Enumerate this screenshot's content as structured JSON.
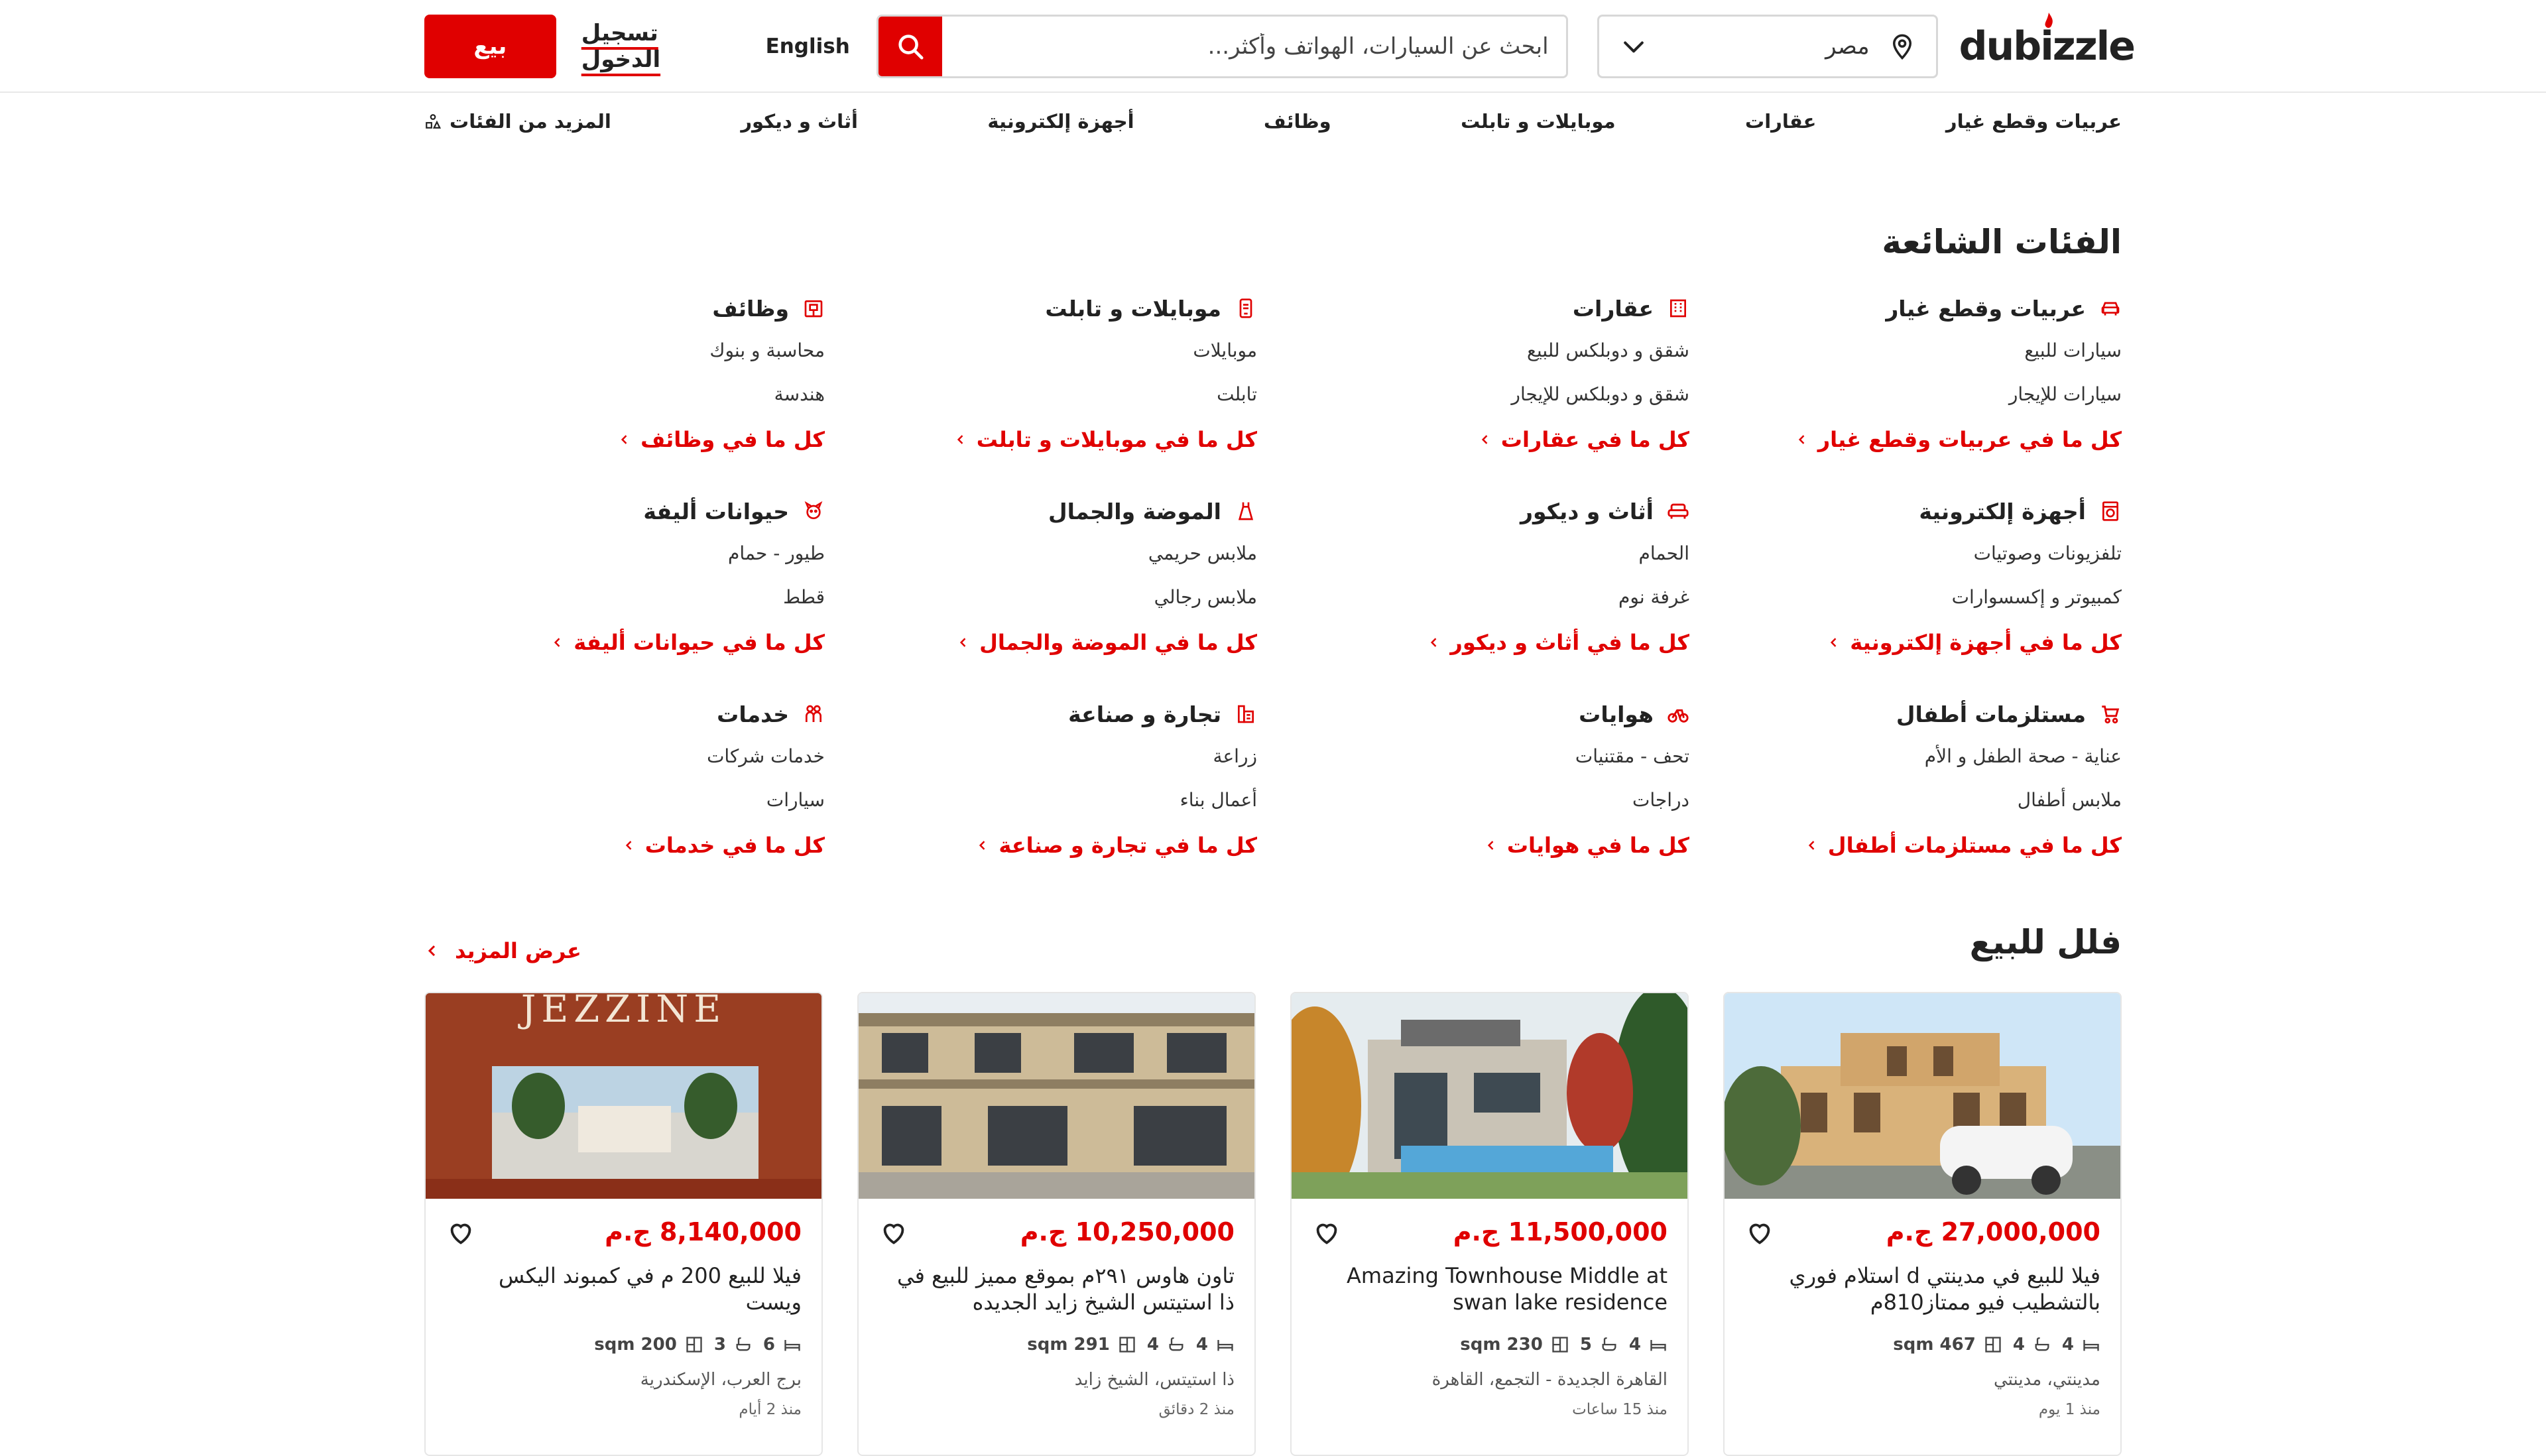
{
  "header": {
    "logo_text": "dubizzle",
    "location": "مصر",
    "search_placeholder": "ابحث عن السيارات، الهواتف وأكثر...",
    "language": "English",
    "login": "تسجيل الدخول",
    "sell": "بيع",
    "accent_color": "#e00000"
  },
  "nav": {
    "items": [
      "عربيات وقطع غيار",
      "عقارات",
      "موبايلات و تابلت",
      "وظائف",
      "أجهزة إلكترونية",
      "أثاث و ديكور",
      "المزيد من الفئات"
    ]
  },
  "popular": {
    "title": "الفئات الشائعة",
    "categories": [
      {
        "name": "عربيات وقطع غيار",
        "icon": "car-icon",
        "subs": [
          "سيارات للبيع",
          "سيارات للإيجار"
        ],
        "see_all": "كل ما في عربيات وقطع غيار"
      },
      {
        "name": "عقارات",
        "icon": "building-icon",
        "subs": [
          "شقق و دوبلكس للبيع",
          "شقق و دوبلكس للإيجار"
        ],
        "see_all": "كل ما في عقارات"
      },
      {
        "name": "موبايلات و تابلت",
        "icon": "phone-icon",
        "subs": [
          "موبايلات",
          "تابلت"
        ],
        "see_all": "كل ما في موبايلات و تابلت"
      },
      {
        "name": "وظائف",
        "icon": "briefcase-icon",
        "subs": [
          "محاسبة و بنوك",
          "هندسة"
        ],
        "see_all": "كل ما في وظائف"
      },
      {
        "name": "أجهزة إلكترونية",
        "icon": "appliance-icon",
        "subs": [
          "تلفزيونات وصوتيات",
          "كمبيوتر و إكسسوارات"
        ],
        "see_all": "كل ما في أجهزة إلكترونية"
      },
      {
        "name": "أثاث و ديكور",
        "icon": "sofa-icon",
        "subs": [
          "الحمام",
          "غرفة نوم"
        ],
        "see_all": "كل ما في أثاث و ديكور"
      },
      {
        "name": "الموضة والجمال",
        "icon": "dress-icon",
        "subs": [
          "ملابس حريمي",
          "ملابس رجالي"
        ],
        "see_all": "كل ما في الموضة والجمال"
      },
      {
        "name": "حيوانات أليفة",
        "icon": "pet-icon",
        "subs": [
          "طيور - حمام",
          "قطط"
        ],
        "see_all": "كل ما في حيوانات أليفة"
      },
      {
        "name": "مستلزمات أطفال",
        "icon": "stroller-icon",
        "subs": [
          "عناية - صحة الطفل و الأم",
          "ملابس أطفال"
        ],
        "see_all": "كل ما في مستلزمات أطفال"
      },
      {
        "name": "هوايات",
        "icon": "bicycle-icon",
        "subs": [
          "تحف - مقتنيات",
          "دراجات"
        ],
        "see_all": "كل ما في هوايات"
      },
      {
        "name": "تجارة و صناعة",
        "icon": "factory-icon",
        "subs": [
          "زراعة",
          "أعمال بناء"
        ],
        "see_all": "كل ما في تجارة و صناعة"
      },
      {
        "name": "خدمات",
        "icon": "people-icon",
        "subs": [
          "خدمات شركات",
          "سيارات"
        ],
        "see_all": "كل ما في خدمات"
      }
    ]
  },
  "villas": {
    "title": "فلل للبيع",
    "more": "عرض المزيد",
    "listings": [
      {
        "price": "27,000,000 ج.م",
        "title": "فيلا للبيع في مدينتي d استلام فوري بالتشطيب فيو ممتاز810م",
        "beds": "4",
        "baths": "4",
        "area": "467 sqm",
        "location": "مدينتي، مدينتي",
        "age": "منذ 1 يوم"
      },
      {
        "price": "11,500,000 ج.م",
        "title": "Amazing Townhouse Middle at swan lake residence",
        "beds": "4",
        "baths": "5",
        "area": "230 sqm",
        "location": "القاهرة الجديدة - التجمع، القاهرة",
        "age": "منذ 15 ساعات"
      },
      {
        "price": "10,250,000 ج.م",
        "title": "تاون هاوس ٢٩١م بموقع مميز للبيع في ذا استيتس الشيخ زايد الجديده",
        "beds": "4",
        "baths": "4",
        "area": "291 sqm",
        "location": "ذا استيتس، الشيخ زايد",
        "age": "منذ 2 دقائق"
      },
      {
        "price": "8,140,000 ج.م",
        "title": "فيلا للبيع 200 م في كمبوند اليكس ويست",
        "beds": "6",
        "baths": "3",
        "area": "200 sqm",
        "location": "برج العرب، الإسكندرية",
        "age": "منذ 2 أيام",
        "image_text": "JEZZINE"
      }
    ]
  }
}
